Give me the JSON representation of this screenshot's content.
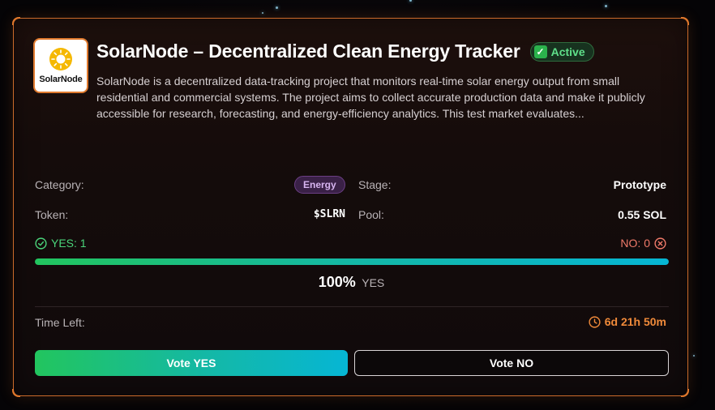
{
  "project": {
    "logo_text": "SolarNode",
    "title": "SolarNode – Decentralized Clean Energy Tracker",
    "status_badge": "Active",
    "description": "SolarNode is a decentralized data-tracking project that monitors real-time solar energy output from small residential and commercial systems. The project aims to collect accurate production data and make it publicly accessible for research, forecasting, and energy-efficiency analytics. This test market evaluates..."
  },
  "details": {
    "category_label": "Category:",
    "category_value": "Energy",
    "stage_label": "Stage:",
    "stage_value": "Prototype",
    "token_label": "Token:",
    "token_value": "$SLRN",
    "pool_label": "Pool:",
    "pool_value": "0.55 SOL"
  },
  "votes": {
    "yes_text": "YES: 1",
    "no_text": "NO: 0",
    "yes_fraction": 1.0,
    "percent_value": "100%",
    "percent_label": "YES"
  },
  "time": {
    "label": "Time Left:",
    "value": "6d 21h 50m"
  },
  "actions": {
    "vote_yes": "Vote YES",
    "vote_no": "Vote NO"
  },
  "colors": {
    "accent_orange": "#e0782c",
    "yes_green": "#22c55e",
    "yes_cyan": "#06b6d4",
    "no_red": "#f07a6a",
    "energy_chip": "#3a2147"
  },
  "icons": {
    "logo": "sun-icon",
    "status": "checkmark-box-icon",
    "yes": "check-circle-icon",
    "no": "x-circle-icon",
    "time": "clock-icon"
  }
}
